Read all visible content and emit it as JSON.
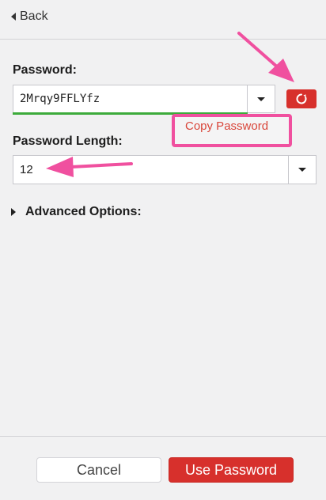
{
  "header": {
    "back_label": "Back"
  },
  "password": {
    "label": "Password:",
    "value": "2Mrqy9FFLYfz",
    "copy_label": "Copy Password"
  },
  "length": {
    "label": "Password Length:",
    "value": "12"
  },
  "advanced": {
    "label": "Advanced Options:"
  },
  "footer": {
    "cancel_label": "Cancel",
    "use_label": "Use Password"
  },
  "colors": {
    "accent": "#d7302c",
    "strength": "#3dab3b",
    "annotation": "#f0509f"
  },
  "icons": [
    "chevron-left-icon",
    "chevron-down-icon",
    "refresh-icon",
    "chevron-right-icon",
    "annotation-arrow"
  ]
}
